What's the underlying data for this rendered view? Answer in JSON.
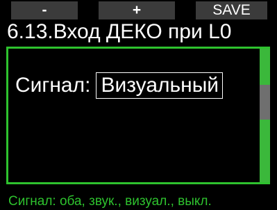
{
  "softkeys": {
    "minus_label": "-",
    "plus_label": "+",
    "save_label": "SAVE"
  },
  "screen": {
    "title": "6.13.Вход ДЕКО при L0"
  },
  "setting": {
    "label": "Сигнал:",
    "value": "Визуальный"
  },
  "hint": {
    "text": "Сигнал: оба, звук., визуал., выкл."
  },
  "colors": {
    "accent": "#2ec22e",
    "softkey_bg": "#3b3b3b",
    "scroll_thumb": "#6f6f6f",
    "background": "#000000",
    "text": "#ffffff"
  },
  "scrollbar": {
    "position_fraction": 0.33
  }
}
